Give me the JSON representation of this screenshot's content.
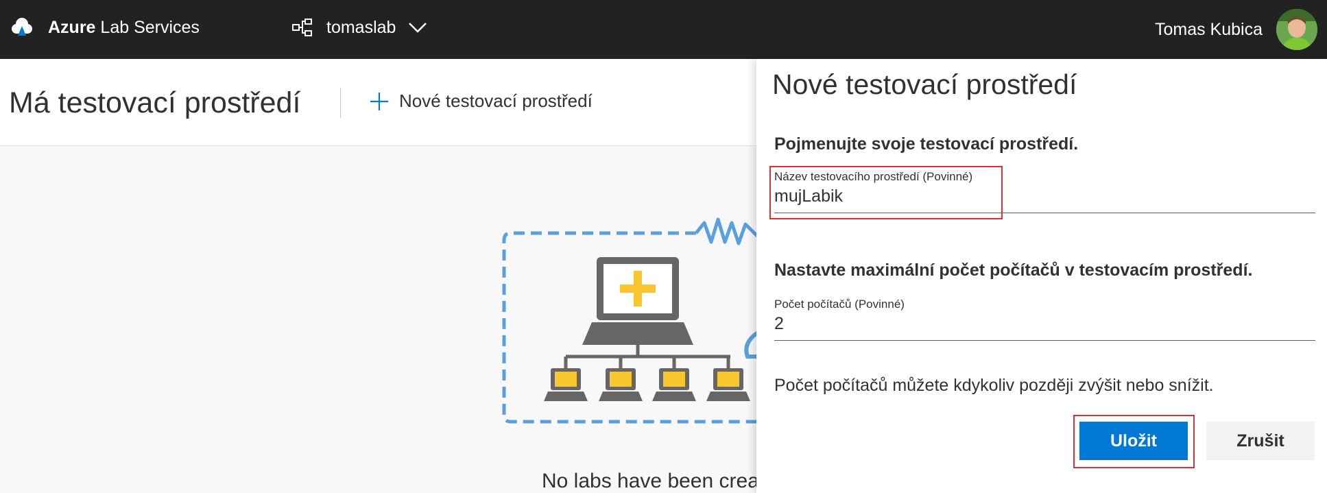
{
  "topbar": {
    "brand_bold": "Azure",
    "brand_rest": " Lab Services",
    "lab_name": "tomaslab",
    "user_name": "Tomas Kubica",
    "icons": [
      "azure-cloud-icon",
      "lab-hierarchy-icon",
      "chevron-down-icon",
      "avatar"
    ]
  },
  "header": {
    "title": "Má testovací prostředí",
    "new_lab_label": "Nové testovací prostředí"
  },
  "empty_state": {
    "text": "No labs have been creat"
  },
  "panel": {
    "title": "Nové testovací prostředí",
    "section_name_heading": "Pojmenujte svoje testovací prostředí.",
    "name_field": {
      "label": "Název testovacího prostředí (Povinné)",
      "value": "mujLabik"
    },
    "section_count_heading": "Nastavte maximální počet počítačů v testovacím prostředí.",
    "count_field": {
      "label": "Počet počítačů (Povinné)",
      "value": "2"
    },
    "hint": "Počet počítačů můžete kdykoliv později zvýšit nebo snížit.",
    "save_label": "Uložit",
    "cancel_label": "Zrušit"
  },
  "colors": {
    "topbar_bg": "#222222",
    "primary": "#0078d4",
    "highlight": "#d13438",
    "illustration_blue": "#5aa0dc",
    "illustration_yellow": "#f8c62f",
    "illustration_gray": "#666666"
  }
}
